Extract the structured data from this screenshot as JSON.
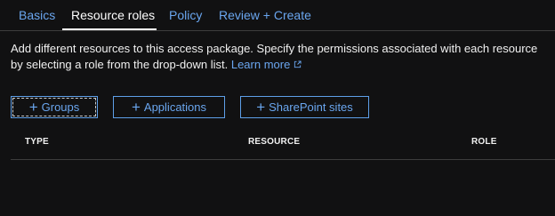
{
  "tabs": [
    {
      "label": "Basics",
      "active": false
    },
    {
      "label": "Resource roles",
      "active": true
    },
    {
      "label": "Policy",
      "active": false
    },
    {
      "label": "Review + Create",
      "active": false
    }
  ],
  "description": {
    "text": "Add different resources to this access package. Specify the permissions associated with each resource by selecting a role from the drop-down list.",
    "learn_more": "Learn more",
    "learn_more_icon": "external-link-icon"
  },
  "buttons": {
    "groups": "Groups",
    "applications": "Applications",
    "sharepoint": "SharePoint sites",
    "plus_icon": "+"
  },
  "table": {
    "columns": [
      "TYPE",
      "RESOURCE",
      "ROLE"
    ]
  },
  "colors": {
    "background": "#111112",
    "accent": "#6aa6ef",
    "text": "#f0f0f0",
    "divider": "#3d3d3d"
  }
}
